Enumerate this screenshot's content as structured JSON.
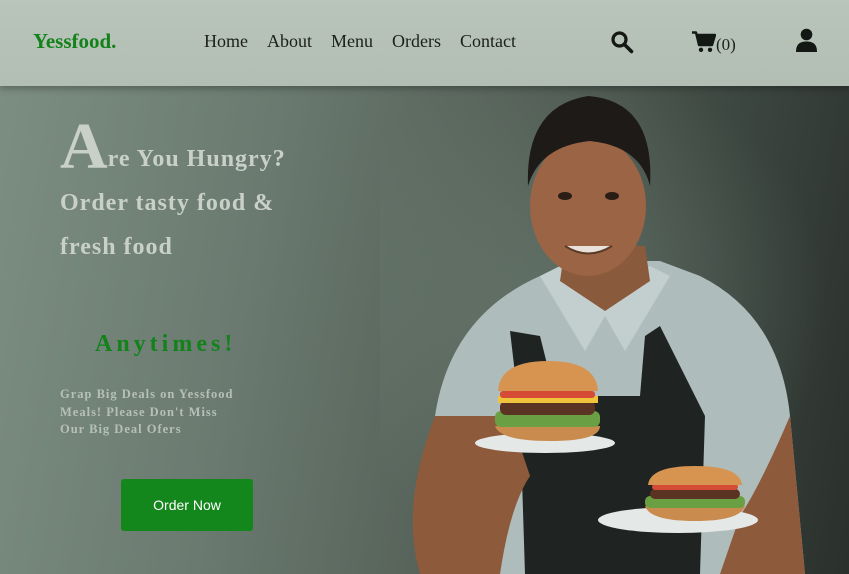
{
  "navbar": {
    "logo": "Yessfood.",
    "links": [
      "Home",
      "About",
      "Menu",
      "Orders",
      "Contact"
    ],
    "cart_count": "(0)",
    "icons": {
      "search": "search-icon",
      "cart": "cart-icon",
      "user": "user-icon"
    }
  },
  "hero": {
    "headline_first_letter": "A",
    "headline_rest": "re You Hungry? Order tasty food & fresh food",
    "highlight": "Anytimes!",
    "subtext": "Grap Big Deals on Yessfood Meals! Please Don't Miss Our Big Deal Ofers",
    "cta_label": "Order Now"
  },
  "colors": {
    "brand_green": "#13821b",
    "navbar_bg": "#b9c4ba",
    "hero_text": "#c8d0c9"
  }
}
